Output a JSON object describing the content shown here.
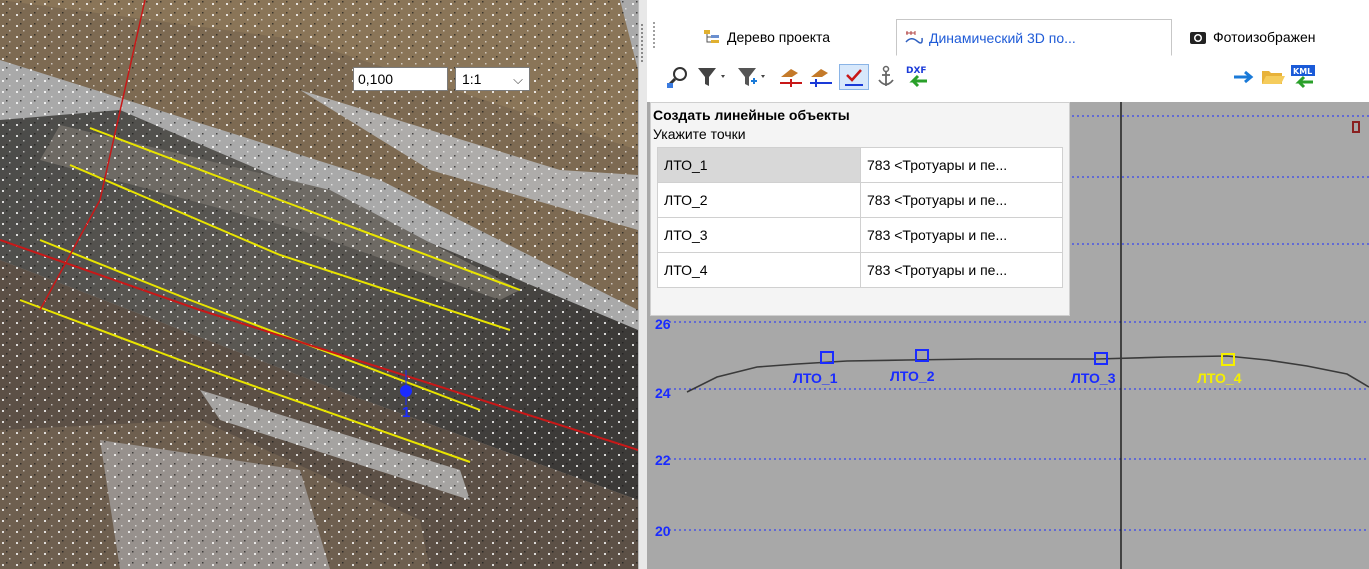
{
  "tabs": [
    {
      "label": "Дерево проекта",
      "icon": "project-tree-icon"
    },
    {
      "label": "Динамический 3D по...",
      "icon": "dynamic-3d-profile-icon",
      "active": true
    },
    {
      "label": "Фотоизображен",
      "icon": "camera-icon"
    }
  ],
  "toolbar": {
    "icons": [
      "select-zoom-icon",
      "filter-icon",
      "filter-add-icon",
      "measure-pick-icon",
      "measure-pick-2-icon",
      "checkbox-line-icon",
      "anchor-icon",
      "dxf-import-icon",
      "arrow-right-icon",
      "folder-open-icon",
      "kml-import-icon"
    ],
    "scale_value": "0,100",
    "ratio_value": "1:1"
  },
  "command_panel": {
    "title": "Создать линейные объекты",
    "hint": "Укажите точки",
    "rows": [
      {
        "name": "ЛТО_1",
        "type": "783 <Тротуары и пе..."
      },
      {
        "name": "ЛТО_2",
        "type": "783 <Тротуары и пе..."
      },
      {
        "name": "ЛТО_3",
        "type": "783 <Тротуары и пе..."
      },
      {
        "name": "ЛТО_4",
        "type": "783 <Тротуары и пе..."
      }
    ]
  },
  "profile": {
    "y_labels": [
      "26",
      "24",
      "22",
      "20"
    ],
    "markers": [
      "ЛТО_1",
      "ЛТО_2",
      "ЛТО_3",
      "ЛТО_4"
    ],
    "marker_color": "#1a2bff",
    "highlight_color": "#f5f000"
  },
  "view3d": {
    "point_label": "1",
    "line_yellow": "#e8e400",
    "line_red": "#c81818"
  }
}
